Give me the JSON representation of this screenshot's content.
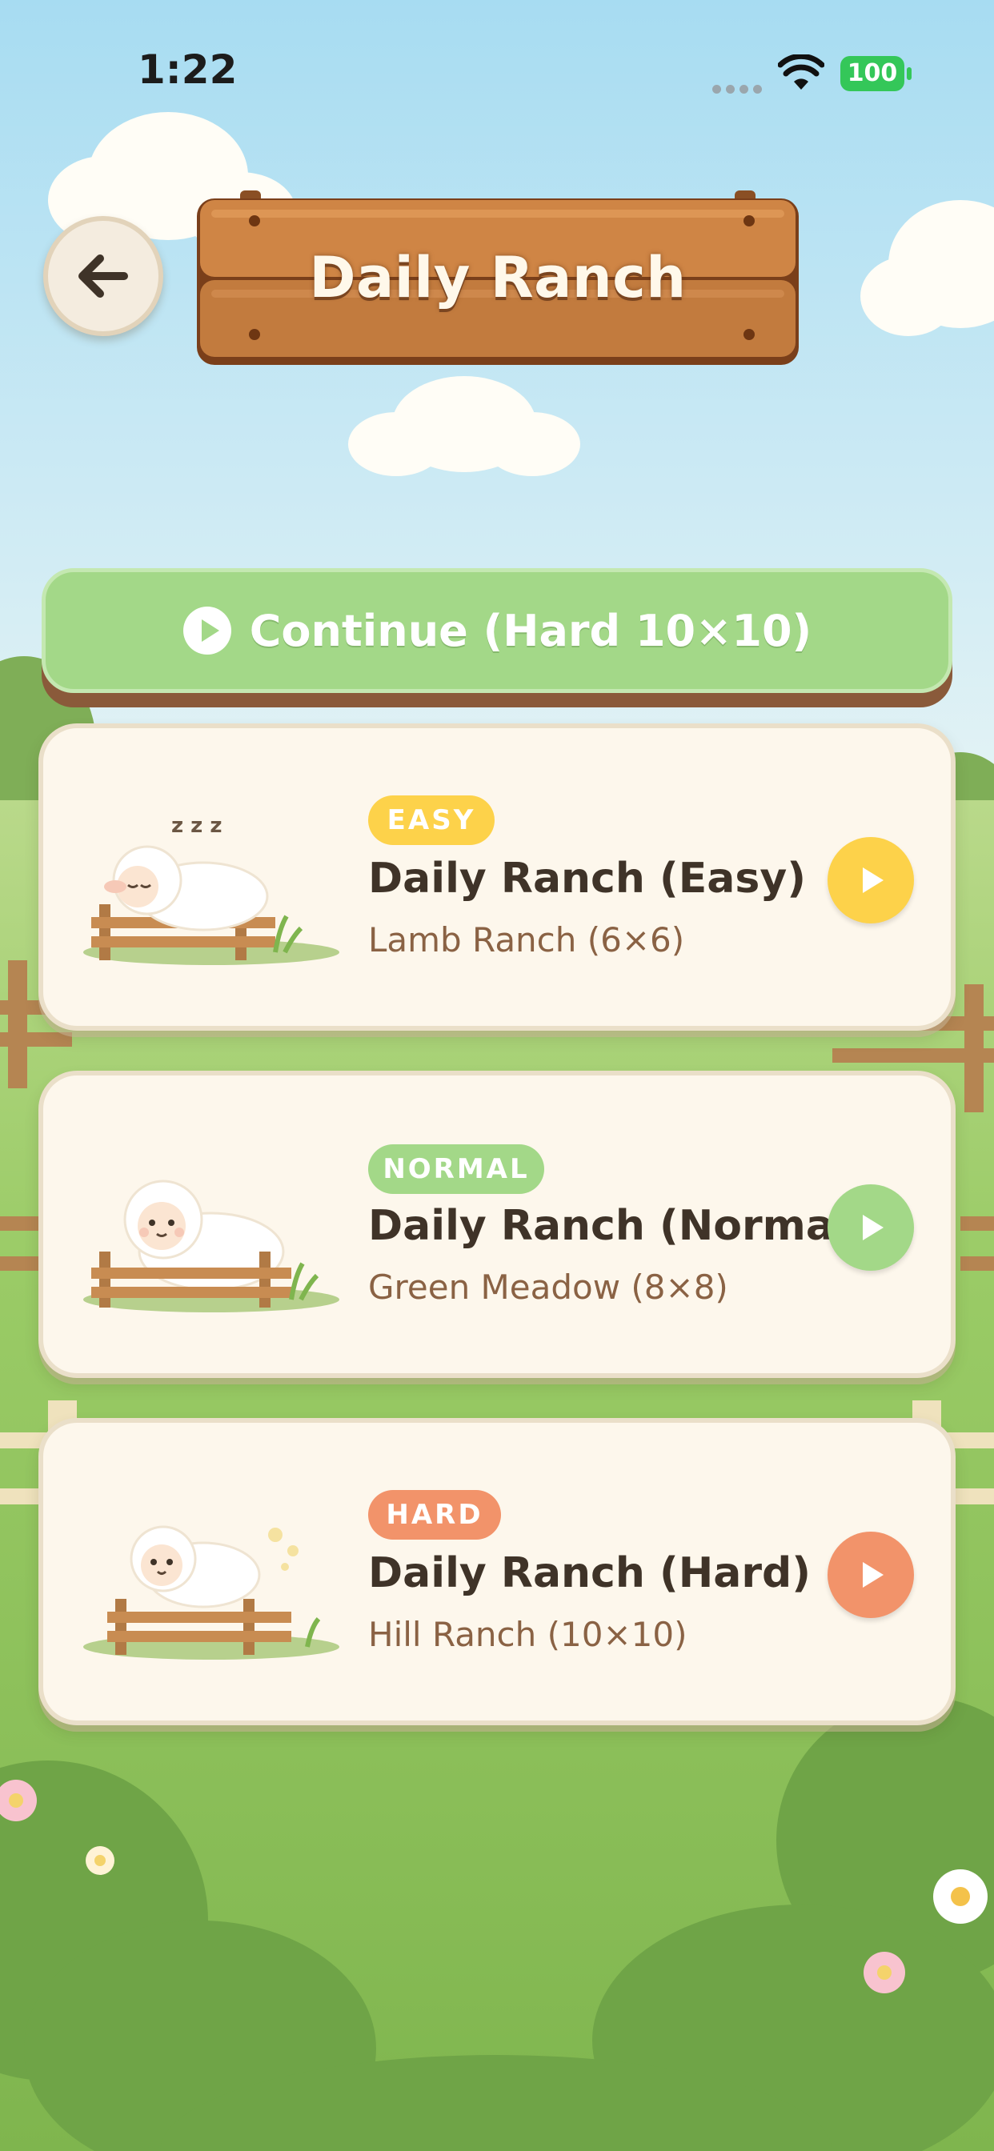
{
  "status_bar": {
    "time": "1:22",
    "battery": "100"
  },
  "header": {
    "title": "Daily Ranch",
    "back_icon": "arrow-left-icon"
  },
  "continue_button": {
    "label": "Continue (Hard 10×10)",
    "icon": "play-circle-icon"
  },
  "colors": {
    "sky": "#a9dcf0",
    "grass": "#8fc25c",
    "continue": "#a3d888",
    "easy": "#fdd24a",
    "normal": "#a3d888",
    "hard": "#f2936a",
    "wood": "#c47a40",
    "card_bg": "#fdf7ec"
  },
  "levels": [
    {
      "badge": "EASY",
      "title": "Daily Ranch (Easy)",
      "subtitle": "Lamb Ranch (6×6)",
      "color": "#fdd24a",
      "art": "sleeping-sheep-icon",
      "action_icon": "play-icon"
    },
    {
      "badge": "NORMAL",
      "title": "Daily Ranch (Normal)",
      "subtitle": "Green Meadow (8×8)",
      "color": "#a3d888",
      "art": "sitting-sheep-icon",
      "action_icon": "play-icon"
    },
    {
      "badge": "HARD",
      "title": "Daily Ranch (Hard)",
      "subtitle": "Hill Ranch (10×10)",
      "color": "#f2936a",
      "art": "jumping-sheep-icon",
      "action_icon": "play-icon"
    }
  ]
}
